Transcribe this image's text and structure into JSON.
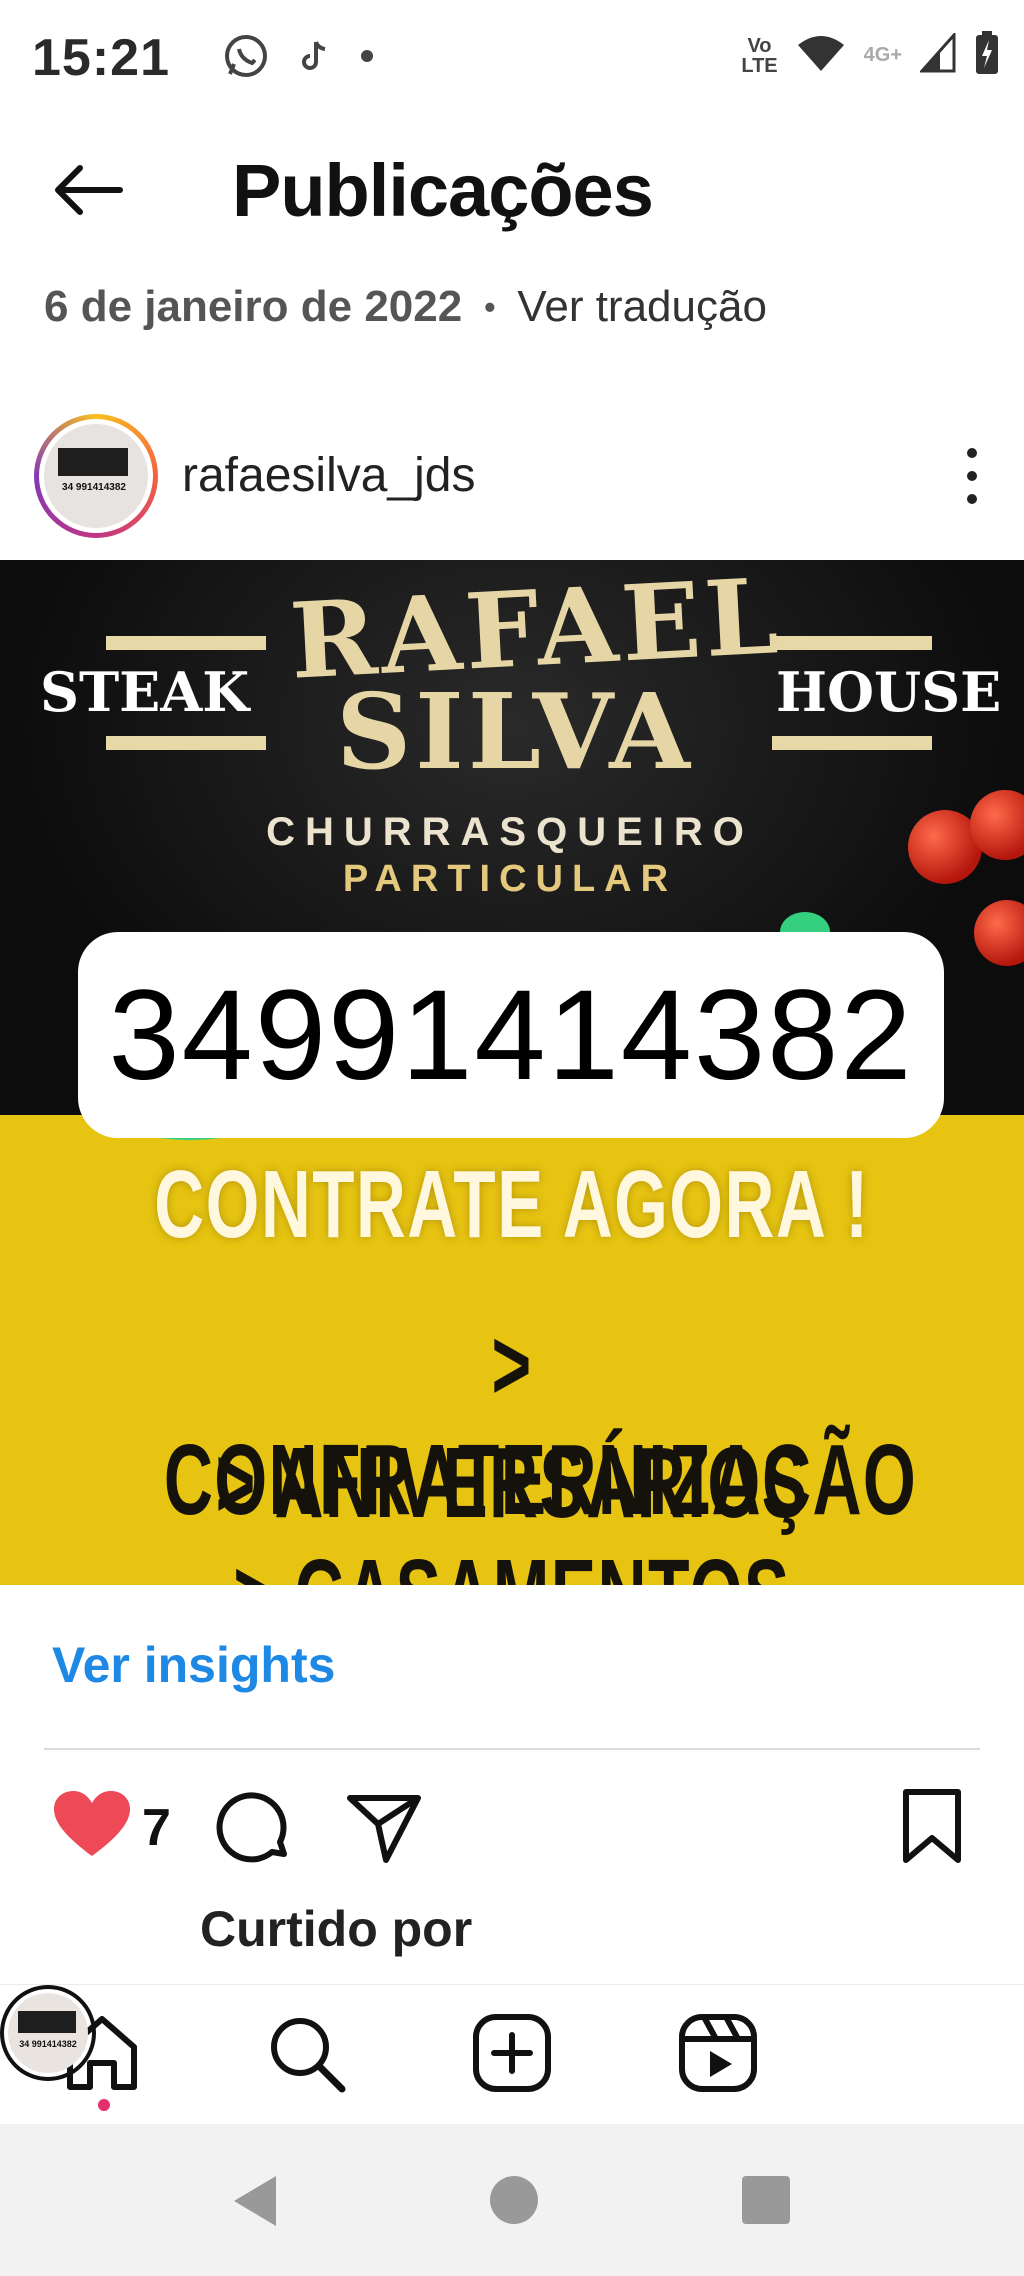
{
  "status_bar": {
    "time": "15:21",
    "left_icons": [
      "whatsapp-icon",
      "tiktok-icon",
      "notification-dot-icon"
    ],
    "volte_line1": "Vo",
    "volte_line2": "LTE",
    "network": "4G+",
    "right_icons": [
      "volte-icon",
      "wifi-icon",
      "signal-icon",
      "battery-charging-icon"
    ]
  },
  "header": {
    "title": "Publicações",
    "back_icon": "back-arrow-icon"
  },
  "post_meta": {
    "date": "6 de janeiro de 2022",
    "separator": "•",
    "translate_label": "Ver tradução"
  },
  "post": {
    "username": "rafaesilva_jds",
    "avatar_text": "34 991414382",
    "image": {
      "left_label": "STEAK",
      "right_label": "HOUSE",
      "name_line1": "RAFAEL",
      "name_line2": "SILVA",
      "subtitle_line1": "CHURRASQUEIRO",
      "subtitle_line2": "PARTICULAR",
      "phone": "34991414382",
      "cta_title": "CONTRATE AGORA !",
      "services": [
        "> CONFRATERNIZAÇÃO",
        "> ANIVERSÁRIOS",
        "> CASAMENTOS"
      ],
      "colors": {
        "dark_bg": "#0c0c0c",
        "yellow_bg": "#e6c411",
        "gold": "#e7d6a5"
      }
    }
  },
  "insights_label": "Ver insights",
  "actions": {
    "like_count": "7",
    "liked": true,
    "icons": [
      "heart-filled-icon",
      "comment-icon",
      "share-icon",
      "bookmark-icon"
    ]
  },
  "liked_by_label": "Curtido por",
  "bottom_nav": {
    "items": [
      "home-icon",
      "search-icon",
      "create-icon",
      "reels-icon",
      "profile-avatar"
    ],
    "profile_avatar_text": "34 991414382"
  },
  "system_nav": [
    "back-icon",
    "home-icon",
    "recents-icon"
  ],
  "accent_colors": {
    "link_blue": "#1e88e5",
    "like_red": "#ed4956"
  }
}
